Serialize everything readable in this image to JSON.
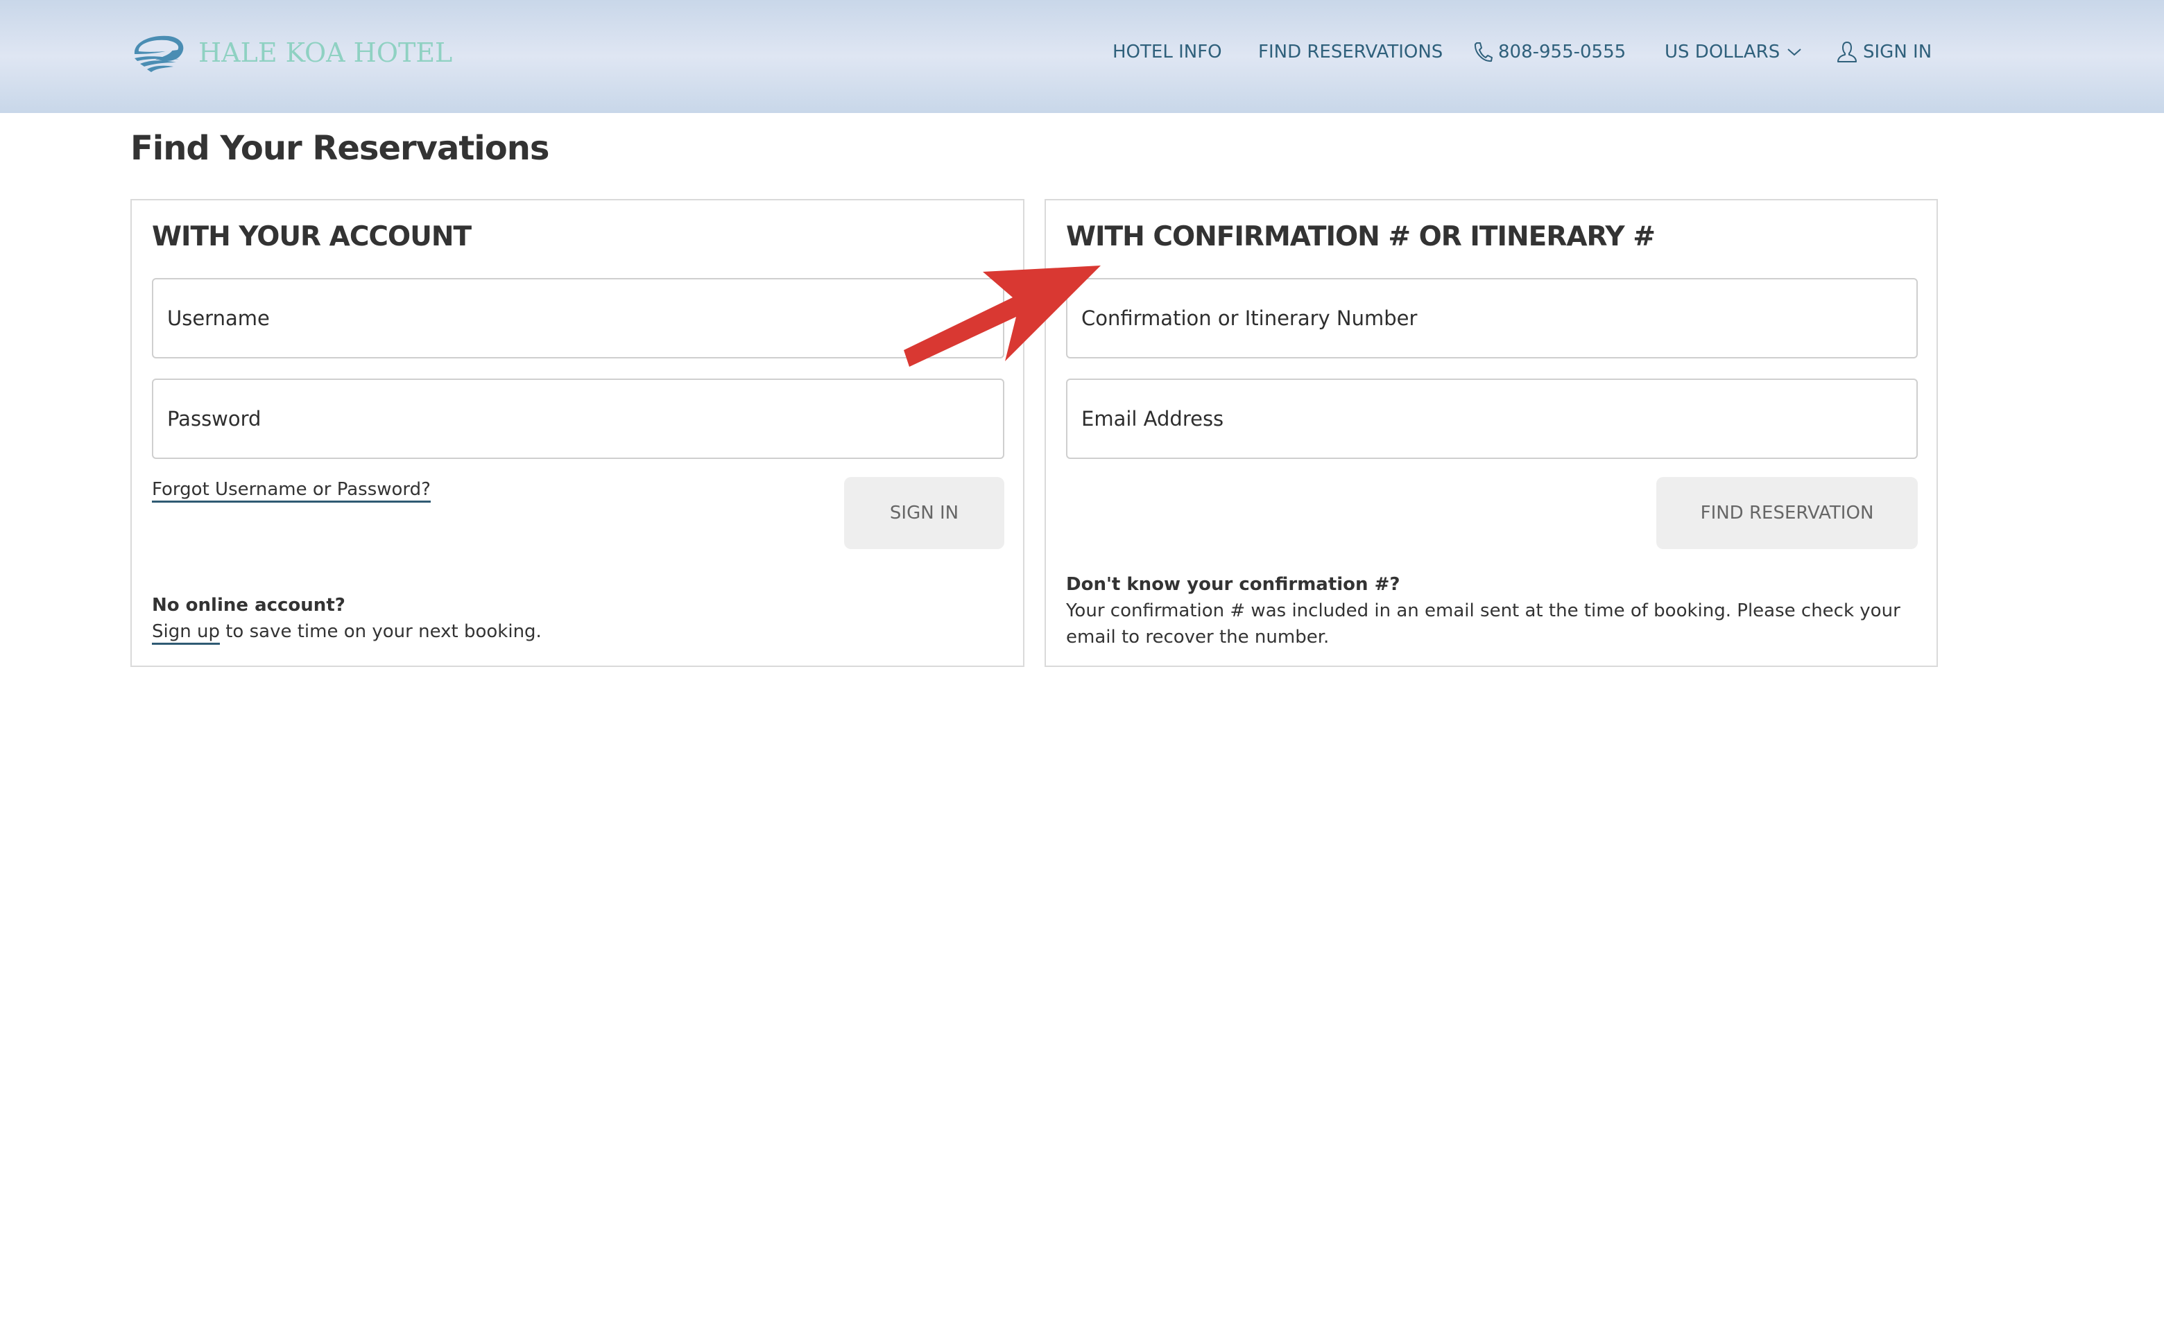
{
  "header": {
    "logo_text": "HALE KOA HOTEL",
    "nav": {
      "hotel_info": "HOTEL INFO",
      "find_reservations": "FIND RESERVATIONS",
      "phone": "808-955-0555",
      "currency": "US DOLLARS",
      "sign_in": "SIGN IN"
    },
    "icons": {
      "phone": "phone-icon",
      "currency_dropdown": "chevron-down-icon",
      "user": "user-icon"
    }
  },
  "page": {
    "title": "Find Your Reservations"
  },
  "account_panel": {
    "heading": "WITH YOUR ACCOUNT",
    "username": {
      "value": "",
      "placeholder": "Username"
    },
    "password": {
      "value": "",
      "placeholder": "Password"
    },
    "forgot_link": "Forgot Username or Password?",
    "sign_in_button": "SIGN IN",
    "no_account_heading": "No online account?",
    "sign_up_link": "Sign up",
    "sign_up_suffix": " to save time on your next booking."
  },
  "confirmation_panel": {
    "heading": "WITH CONFIRMATION # OR ITINERARY #",
    "confirmation": {
      "value": "",
      "placeholder": "Confirmation or Itinerary Number"
    },
    "email": {
      "value": "",
      "placeholder": "Email Address"
    },
    "find_button": "FIND RESERVATION",
    "help_heading": "Don't know your confirmation #?",
    "help_text": "Your confirmation # was included in an email sent at the time of booking. Please check your email to recover the number."
  },
  "annotation": {
    "type": "arrow",
    "color": "#d93832",
    "points_to": "Confirmation or Itinerary Number field"
  },
  "colors": {
    "nav_text": "#2f607b",
    "logo_text": "#8fd1c2",
    "logo_mark": "#4a8db3",
    "button_bg": "#eeeeee",
    "button_text": "#666666"
  }
}
